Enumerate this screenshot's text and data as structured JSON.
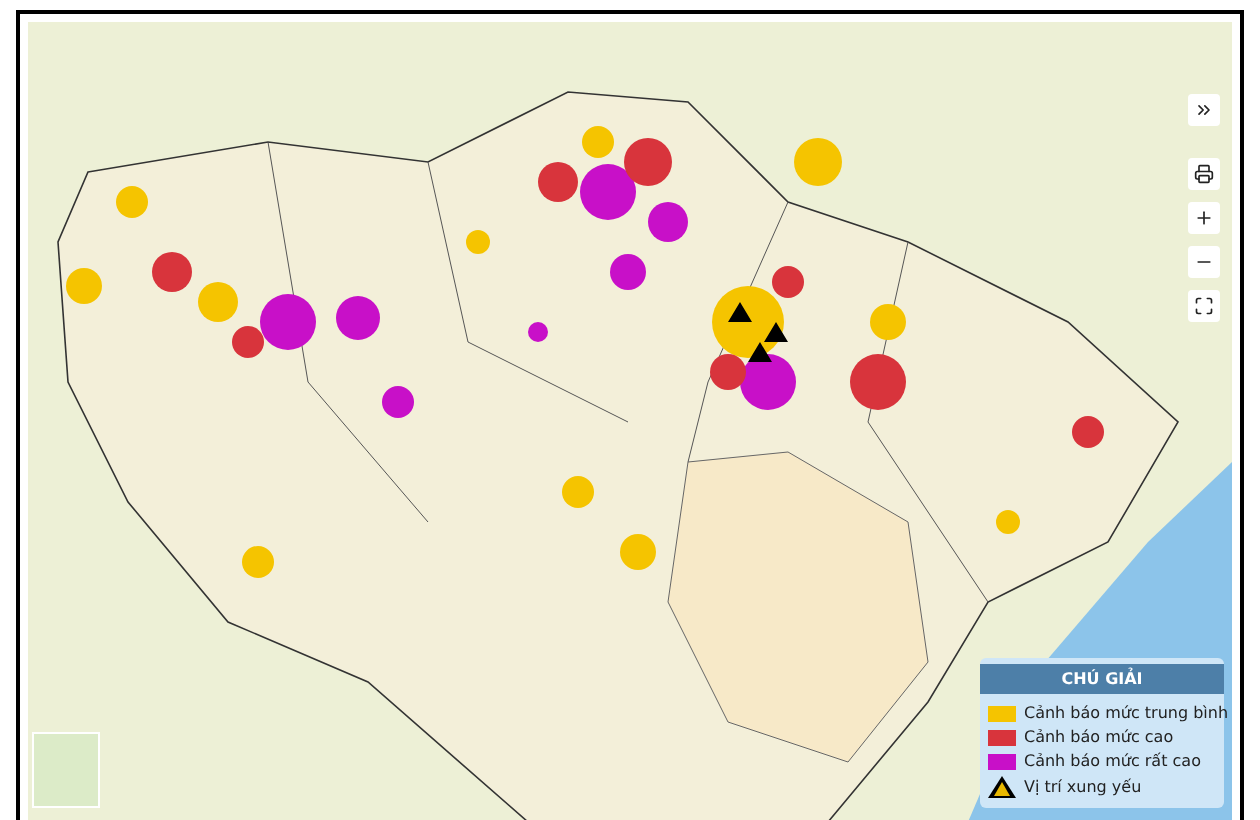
{
  "legend": {
    "title": "CHÚ GIẢI",
    "items": [
      {
        "kind": "swatch",
        "label": "Cảnh báo mức trung bình",
        "color": "#f5c400"
      },
      {
        "kind": "swatch",
        "label": "Cảnh báo mức cao",
        "color": "#d8343c"
      },
      {
        "kind": "swatch",
        "label": "Cảnh báo mức rất cao",
        "color": "#c810c8"
      },
      {
        "kind": "marker",
        "label": "Vị trí xung yếu"
      }
    ]
  }
}
